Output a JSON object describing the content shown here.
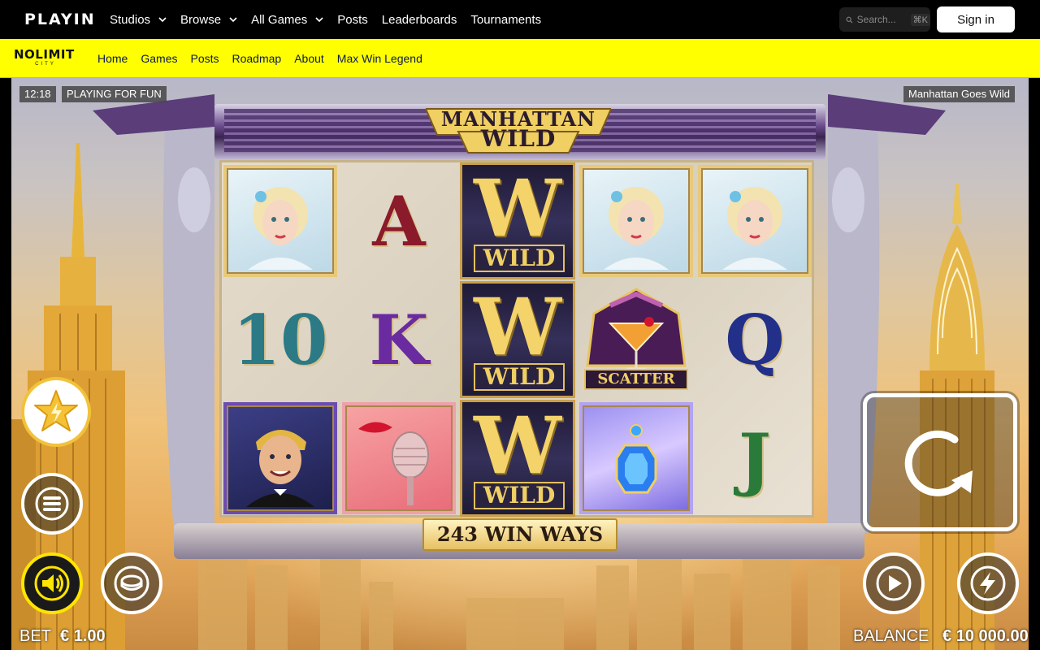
{
  "nav": {
    "logo": "PLAYIN",
    "links": [
      {
        "label": "Studios",
        "dropdown": true
      },
      {
        "label": "Browse",
        "dropdown": true
      },
      {
        "label": "All Games",
        "dropdown": true
      },
      {
        "label": "Posts",
        "dropdown": false
      },
      {
        "label": "Leaderboards",
        "dropdown": false
      },
      {
        "label": "Tournaments",
        "dropdown": false
      }
    ],
    "search_placeholder": "Search...",
    "search_shortcut": "⌘K",
    "signin_label": "Sign in"
  },
  "studio": {
    "logo_main": "NOLIMIT",
    "logo_sub": "CITY",
    "brand_color": "#ffff00",
    "links": [
      "Home",
      "Games",
      "Posts",
      "Roadmap",
      "About",
      "Max Win Legend"
    ]
  },
  "game": {
    "clock": "12:18",
    "mode": "PLAYING FOR FUN",
    "name": "Manhattan Goes Wild",
    "title_line1": "MANHATTAN",
    "title_line2": "WILD",
    "win_ways": "243 WIN WAYS",
    "wild_label": "WILD",
    "wild_letter": "W",
    "scatter_label": "SCATTER",
    "reels": [
      [
        "lady",
        "10",
        "gentleman"
      ],
      [
        "A",
        "K",
        "microphone"
      ],
      [
        "wild",
        "wild",
        "wild"
      ],
      [
        "lady",
        "scatter",
        "jewel"
      ],
      [
        "lady",
        "Q",
        "J"
      ]
    ],
    "bet_label": "BET",
    "bet_value": "€ 1.00",
    "balance_label": "BALANCE",
    "balance_value": "€ 10 000.00",
    "buttons": {
      "feature": "star-icon",
      "menu": "menu-icon",
      "sound": "speaker-icon",
      "bet": "coin-icon",
      "spin": "spin-icon",
      "autoplay": "play-icon",
      "turbo": "lightning-icon"
    }
  }
}
